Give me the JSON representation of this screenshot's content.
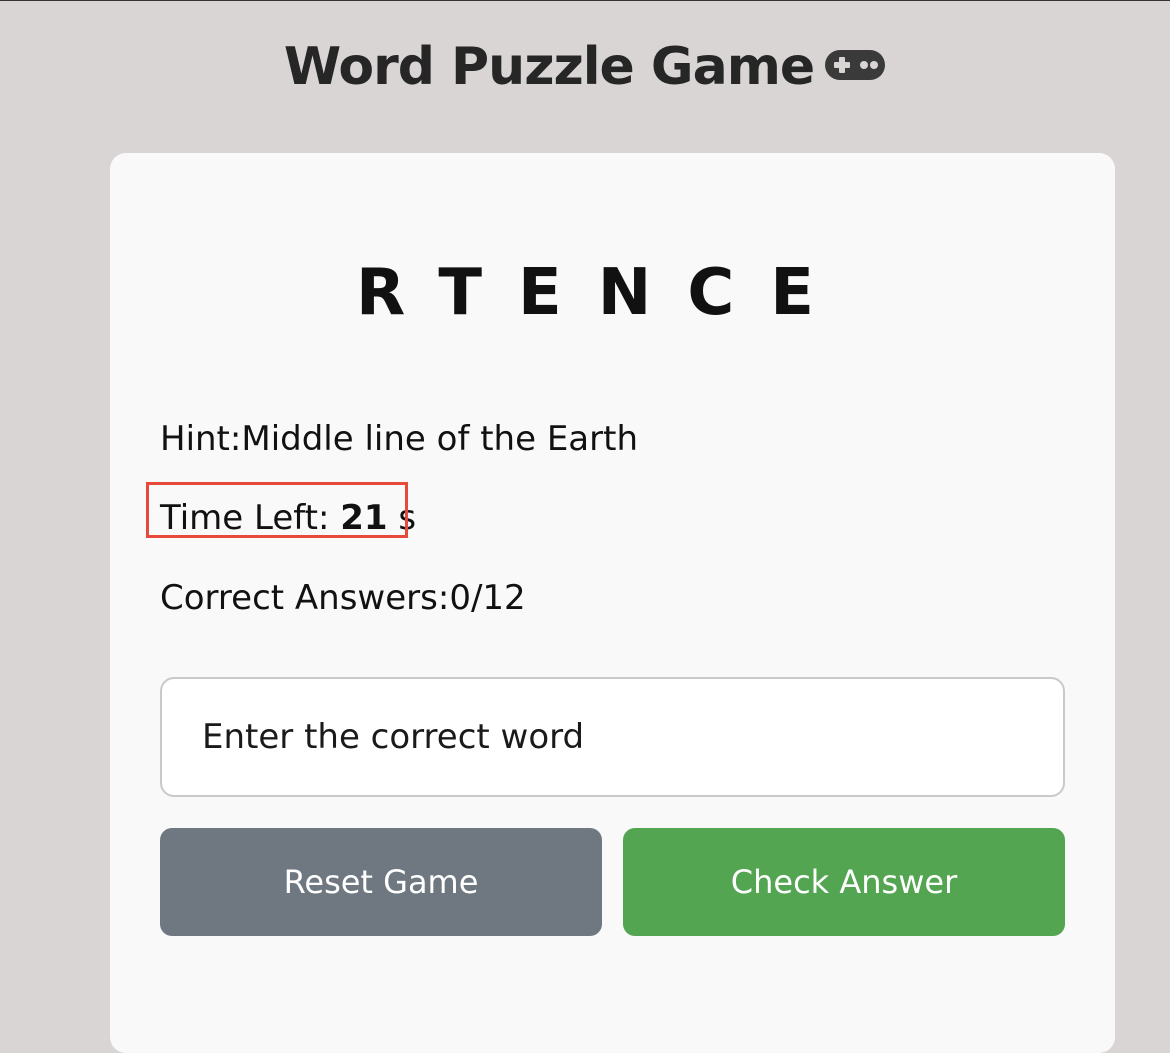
{
  "header": {
    "title": "Word Puzzle Game",
    "icon": "gamepad-icon"
  },
  "puzzle": {
    "scrambled_word": "RTENCE",
    "hint_label": "Hint:",
    "hint_text": "Middle line of the Earth",
    "time_label": "Time Left: ",
    "time_value": "21",
    "time_unit": " s",
    "score_label": "Correct Answers:",
    "score_value": "0/12"
  },
  "input": {
    "value": "",
    "placeholder": "Enter the correct word"
  },
  "buttons": {
    "reset_label": "Reset Game",
    "check_label": "Check Answer"
  },
  "colors": {
    "background": "#d9d5d4",
    "card": "#f9f9f9",
    "reset_button": "#6f7780",
    "check_button": "#53a551",
    "highlight": "#e8493a"
  }
}
